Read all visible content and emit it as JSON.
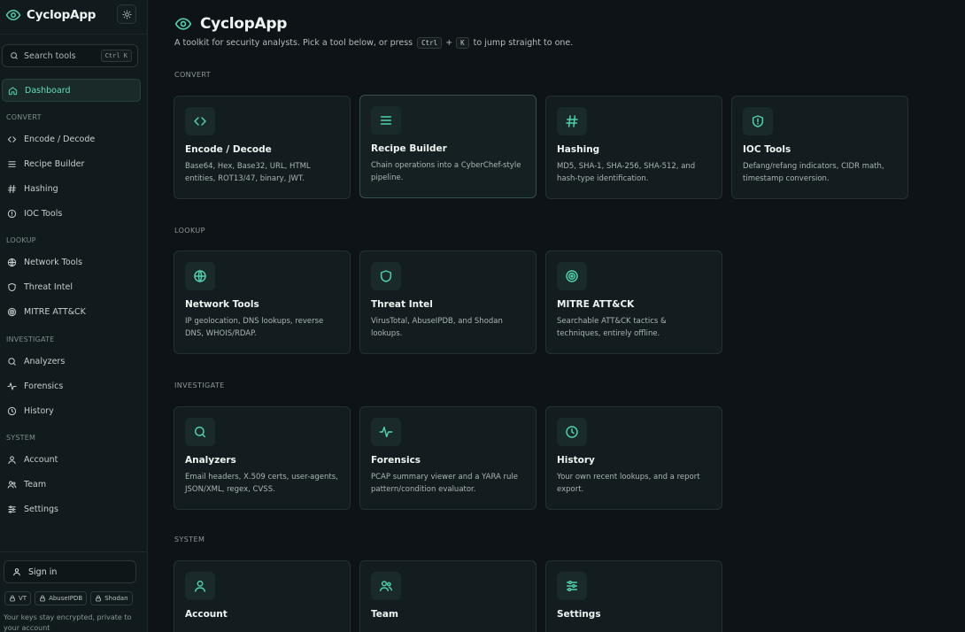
{
  "app": {
    "name": "CyclopApp"
  },
  "colors": {
    "accent": "#4fd1b0",
    "background": "#0d1316",
    "sidebar": "#111a1c",
    "card": "#131c1e"
  },
  "sidebar": {
    "search": {
      "label": "Search tools",
      "shortcut": "Ctrl K"
    },
    "dashboard": {
      "label": "Dashboard",
      "icon": "home-icon"
    },
    "sections": [
      {
        "label": "CONVERT",
        "items": [
          {
            "label": "Encode / Decode",
            "icon": "code-icon"
          },
          {
            "label": "Recipe Builder",
            "icon": "menu-icon"
          },
          {
            "label": "Hashing",
            "icon": "hash-icon"
          },
          {
            "label": "IOC Tools",
            "icon": "shield-alert-icon"
          }
        ]
      },
      {
        "label": "LOOKUP",
        "items": [
          {
            "label": "Network Tools",
            "icon": "globe-icon"
          },
          {
            "label": "Threat Intel",
            "icon": "shield-icon"
          },
          {
            "label": "MITRE ATT&CK",
            "icon": "target-icon"
          }
        ]
      },
      {
        "label": "INVESTIGATE",
        "items": [
          {
            "label": "Analyzers",
            "icon": "search-icon"
          },
          {
            "label": "Forensics",
            "icon": "activity-icon"
          },
          {
            "label": "History",
            "icon": "clock-icon"
          }
        ]
      },
      {
        "label": "SYSTEM",
        "items": [
          {
            "label": "Account",
            "icon": "user-icon"
          },
          {
            "label": "Team",
            "icon": "users-icon"
          },
          {
            "label": "Settings",
            "icon": "sliders-icon"
          }
        ]
      }
    ],
    "signin": "Sign in",
    "key_chips": [
      "VT",
      "AbuseIPDB",
      "Shodan"
    ],
    "note": "Your keys stay encrypted, private to your account"
  },
  "main": {
    "title": "CyclopApp",
    "subtitle_before": "A toolkit for security analysts. Pick a tool below, or press",
    "kbd_ctrl": "Ctrl",
    "kbd_plus": "+",
    "kbd_k": "K",
    "subtitle_after": "to jump straight to one.",
    "sections": [
      {
        "label": "CONVERT",
        "cards": [
          {
            "title": "Encode / Decode",
            "desc": "Base64, Hex, Base32, URL, HTML entities, ROT13/47, binary, JWT.",
            "icon": "code-icon"
          },
          {
            "title": "Recipe Builder",
            "desc": "Chain operations into a CyberChef-style pipeline.",
            "icon": "menu-icon"
          },
          {
            "title": "Hashing",
            "desc": "MD5, SHA-1, SHA-256, SHA-512, and hash-type identification.",
            "icon": "hash-icon"
          },
          {
            "title": "IOC Tools",
            "desc": "Defang/refang indicators, CIDR math, timestamp conversion.",
            "icon": "shield-alert-icon"
          }
        ]
      },
      {
        "label": "LOOKUP",
        "cards": [
          {
            "title": "Network Tools",
            "desc": "IP geolocation, DNS lookups, reverse DNS, WHOIS/RDAP.",
            "icon": "globe-icon"
          },
          {
            "title": "Threat Intel",
            "desc": "VirusTotal, AbuseIPDB, and Shodan lookups.",
            "icon": "shield-icon"
          },
          {
            "title": "MITRE ATT&CK",
            "desc": "Searchable ATT&CK tactics & techniques, entirely offline.",
            "icon": "target-icon"
          }
        ]
      },
      {
        "label": "INVESTIGATE",
        "cards": [
          {
            "title": "Analyzers",
            "desc": "Email headers, X.509 certs, user-agents, JSON/XML, regex, CVSS.",
            "icon": "search-icon"
          },
          {
            "title": "Forensics",
            "desc": "PCAP summary viewer and a YARA rule pattern/condition evaluator.",
            "icon": "activity-icon"
          },
          {
            "title": "History",
            "desc": "Your own recent lookups, and a report export.",
            "icon": "clock-icon"
          }
        ]
      },
      {
        "label": "SYSTEM",
        "cards": [
          {
            "title": "Account",
            "desc": "",
            "icon": "user-icon"
          },
          {
            "title": "Team",
            "desc": "",
            "icon": "users-icon"
          },
          {
            "title": "Settings",
            "desc": "",
            "icon": "sliders-icon"
          }
        ]
      }
    ]
  }
}
